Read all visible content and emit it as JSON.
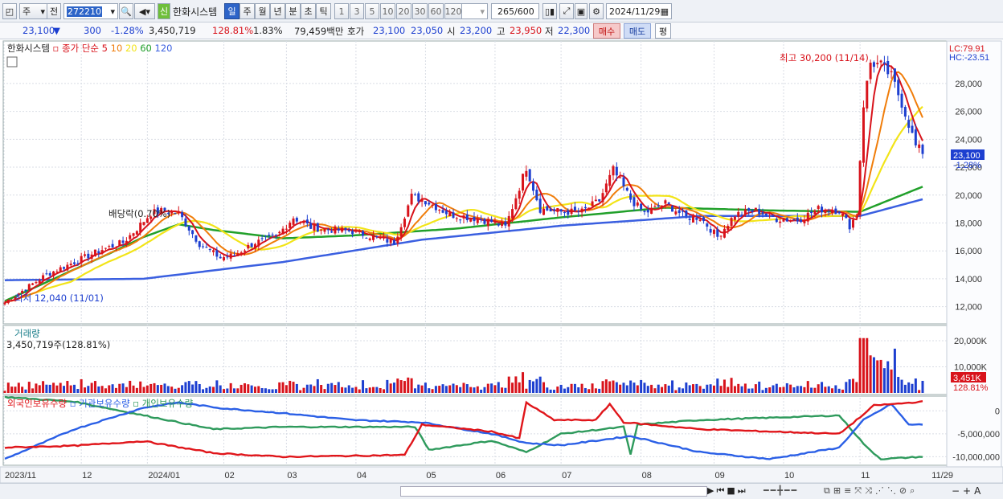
{
  "toolbar": {
    "market": "주",
    "prev_label": "전",
    "code": "272210",
    "new_badge": "신",
    "stock_name": "한화시스템",
    "periods": [
      "일",
      "주",
      "월",
      "년",
      "분",
      "초",
      "틱"
    ],
    "active_period": "일",
    "intervals": [
      "1",
      "3",
      "5",
      "10",
      "20",
      "30",
      "60",
      "120"
    ],
    "count": "265",
    "total": "/600",
    "date": "2024/11/29"
  },
  "quote": {
    "price": "23,100",
    "change": "300",
    "change_pct": "-1.28%",
    "volume": "3,450,719",
    "volume_ratio": "128.81%",
    "turnover_pct": "1.83%",
    "amount": "79,459백만",
    "hoga_label": "호가",
    "ask": "23,100",
    "bid": "23,050",
    "open_label": "시",
    "open": "23,200",
    "high_label": "고",
    "high": "23,950",
    "low_label": "저",
    "low": "22,300",
    "sell_button": "매수",
    "buy_button": "매도",
    "eval_button": "평"
  },
  "legend": {
    "name": "한화시스템",
    "series_label": "종가 단순",
    "ma": [
      {
        "label": "5",
        "color": "#d8131b"
      },
      {
        "label": "10",
        "color": "#f07d0a"
      },
      {
        "label": "20",
        "color": "#f2e418"
      },
      {
        "label": "60",
        "color": "#21a02a"
      },
      {
        "label": "120",
        "color": "#3a5fe0"
      }
    ]
  },
  "annotations": {
    "high": "최고 30,200 (11/14)",
    "low": "최저 12,040 (11/01)",
    "dividend": "배당락(0.70%)",
    "lc": "LC:79.91",
    "hc": "HC:-23.51",
    "price_tag": "23,100",
    "pct_tag": "-1.28%"
  },
  "volume_panel": {
    "title": "거래량",
    "value": "3,450,719주(128.81%)",
    "tag": "3,451K",
    "tag_pct": "128.81%"
  },
  "holding_panel": {
    "foreign": "외국인보유수량",
    "institution": "기관보유수량",
    "individual": "개인보유수량"
  },
  "colors": {
    "up": "#d8131b",
    "down": "#1d3fd0",
    "foreign": "#e0151a",
    "institution": "#2a5fe6",
    "individual": "#2e9a5c"
  },
  "chart_data": {
    "type": "candlestick",
    "xlabel": "",
    "ylabel": "",
    "ylim": [
      11000,
      30700
    ],
    "y_ticks": [
      12000,
      14000,
      16000,
      18000,
      20000,
      22000,
      24000,
      26000,
      28000
    ],
    "y_tick_labels": [
      "12,000",
      "14,000",
      "16,000",
      "18,000",
      "20,000",
      "22,000",
      "24,000",
      "26,000",
      "28,000"
    ],
    "x_tick_labels": [
      "2023/11",
      "12",
      "2024/01",
      "02",
      "03",
      "04",
      "05",
      "06",
      "07",
      "08",
      "09",
      "10",
      "11",
      "11/29"
    ],
    "x_tick_index": [
      0,
      22,
      41,
      63,
      81,
      101,
      121,
      141,
      160,
      183,
      204,
      224,
      246,
      264
    ],
    "close_anchors": [
      [
        0,
        12300
      ],
      [
        6,
        13300
      ],
      [
        12,
        14300
      ],
      [
        20,
        15200
      ],
      [
        28,
        16100
      ],
      [
        34,
        16600
      ],
      [
        38,
        17600
      ],
      [
        42,
        18700
      ],
      [
        46,
        18900
      ],
      [
        50,
        18700
      ],
      [
        56,
        16500
      ],
      [
        62,
        15500
      ],
      [
        66,
        15700
      ],
      [
        72,
        16600
      ],
      [
        78,
        17000
      ],
      [
        83,
        18400
      ],
      [
        88,
        17700
      ],
      [
        95,
        17500
      ],
      [
        100,
        17400
      ],
      [
        106,
        17000
      ],
      [
        112,
        16600
      ],
      [
        117,
        19900
      ],
      [
        121,
        19600
      ],
      [
        128,
        18600
      ],
      [
        134,
        18400
      ],
      [
        140,
        18100
      ],
      [
        144,
        17700
      ],
      [
        150,
        22000
      ],
      [
        154,
        19000
      ],
      [
        160,
        18800
      ],
      [
        166,
        18800
      ],
      [
        171,
        19600
      ],
      [
        175,
        21800
      ],
      [
        180,
        19700
      ],
      [
        184,
        18700
      ],
      [
        190,
        19400
      ],
      [
        196,
        18400
      ],
      [
        200,
        18400
      ],
      [
        205,
        17000
      ],
      [
        210,
        18600
      ],
      [
        216,
        18900
      ],
      [
        222,
        18300
      ],
      [
        228,
        18200
      ],
      [
        234,
        19000
      ],
      [
        240,
        18900
      ],
      [
        243,
        17800
      ],
      [
        245,
        18600
      ],
      [
        247,
        26500
      ],
      [
        249,
        29500
      ],
      [
        252,
        29300
      ],
      [
        255,
        28500
      ],
      [
        258,
        26600
      ],
      [
        260,
        25100
      ],
      [
        262,
        23500
      ],
      [
        264,
        23100
      ]
    ],
    "ma_lines": [
      {
        "name": "60",
        "values_anchor": [
          [
            0,
            12400
          ],
          [
            30,
            15800
          ],
          [
            40,
            17000
          ],
          [
            50,
            17900
          ],
          [
            60,
            17500
          ],
          [
            80,
            16900
          ],
          [
            100,
            17100
          ],
          [
            130,
            17600
          ],
          [
            160,
            18400
          ],
          [
            190,
            19100
          ],
          [
            220,
            18900
          ],
          [
            246,
            18800
          ],
          [
            255,
            19700
          ],
          [
            264,
            20600
          ]
        ]
      },
      {
        "name": "120",
        "values_anchor": [
          [
            0,
            13900
          ],
          [
            40,
            14000
          ],
          [
            80,
            15200
          ],
          [
            120,
            16800
          ],
          [
            160,
            17800
          ],
          [
            200,
            18500
          ],
          [
            246,
            18500
          ],
          [
            264,
            19700
          ]
        ]
      }
    ],
    "volume_ylim": [
      0,
      24000
    ],
    "volume_ticks": [
      10000,
      20000
    ],
    "volume_tick_labels": [
      "10,000K",
      "20,000K"
    ],
    "holding_ylim": [
      -11500000,
      2500000
    ],
    "holding_ticks": [
      0,
      -5000000,
      -10000000
    ],
    "holding_tick_labels": [
      "0",
      "-5,000,000",
      "-10,000,000"
    ],
    "foreign_anchor": [
      [
        0,
        -8000000
      ],
      [
        20,
        -7600000
      ],
      [
        40,
        -6600000
      ],
      [
        60,
        -9200000
      ],
      [
        80,
        -10000000
      ],
      [
        100,
        -9800000
      ],
      [
        115,
        -9600000
      ],
      [
        120,
        -3000000
      ],
      [
        140,
        -4500000
      ],
      [
        148,
        -6000000
      ],
      [
        150,
        1800000
      ],
      [
        158,
        -2000000
      ],
      [
        170,
        -2000000
      ],
      [
        174,
        1500000
      ],
      [
        178,
        -2500000
      ],
      [
        200,
        -4000000
      ],
      [
        240,
        -5000000
      ],
      [
        247,
        -800000
      ],
      [
        250,
        1200000
      ],
      [
        256,
        1500000
      ],
      [
        264,
        2000000
      ]
    ],
    "institution_anchor": [
      [
        0,
        -10500000
      ],
      [
        20,
        -4000000
      ],
      [
        40,
        700000
      ],
      [
        50,
        1800000
      ],
      [
        62,
        600000
      ],
      [
        80,
        -500000
      ],
      [
        100,
        -2000000
      ],
      [
        120,
        -2500000
      ],
      [
        140,
        -5000000
      ],
      [
        150,
        -7000000
      ],
      [
        160,
        -7500000
      ],
      [
        180,
        -5500000
      ],
      [
        200,
        -9000000
      ],
      [
        220,
        -10500000
      ],
      [
        240,
        -8000000
      ],
      [
        247,
        -2000000
      ],
      [
        255,
        1500000
      ],
      [
        260,
        -3000000
      ],
      [
        264,
        -3000000
      ]
    ],
    "individual_anchor": [
      [
        0,
        3000000
      ],
      [
        20,
        2000000
      ],
      [
        40,
        -1000000
      ],
      [
        60,
        -4000000
      ],
      [
        80,
        -3500000
      ],
      [
        100,
        -3500000
      ],
      [
        118,
        -3500000
      ],
      [
        122,
        -8500000
      ],
      [
        140,
        -6500000
      ],
      [
        150,
        -9000000
      ],
      [
        160,
        -5000000
      ],
      [
        178,
        -3500000
      ],
      [
        180,
        -9500000
      ],
      [
        182,
        -3000000
      ],
      [
        200,
        -2000000
      ],
      [
        220,
        -1500000
      ],
      [
        240,
        -1000000
      ],
      [
        248,
        -8000000
      ],
      [
        252,
        -10500000
      ],
      [
        264,
        -10000000
      ]
    ]
  }
}
